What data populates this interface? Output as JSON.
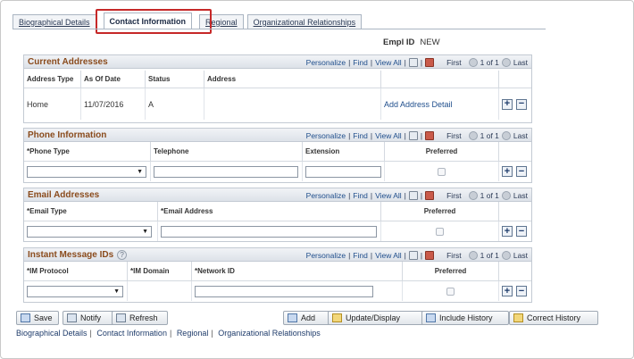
{
  "tabs": [
    {
      "label": "Biographical Details"
    },
    {
      "label": "Contact Information"
    },
    {
      "label": "Regional"
    },
    {
      "label": "Organizational Relationships"
    }
  ],
  "empl": {
    "label": "Empl ID",
    "value": "NEW"
  },
  "nav": {
    "personalize": "Personalize",
    "find": "Find",
    "view_all": "View All",
    "first": "First",
    "range": "1 of 1",
    "last": "Last",
    "sep": "|"
  },
  "addresses": {
    "title": "Current Addresses",
    "columns": [
      "Address Type",
      "As Of Date",
      "Status",
      "Address"
    ],
    "row": {
      "type": "Home",
      "date": "11/07/2016",
      "status": "A",
      "link": "Add Address Detail"
    }
  },
  "phone": {
    "title": "Phone Information",
    "columns": [
      "*Phone Type",
      "Telephone",
      "Extension",
      "Preferred"
    ]
  },
  "email": {
    "title": "Email Addresses",
    "columns": [
      "*Email Type",
      "*Email Address",
      "Preferred"
    ]
  },
  "im": {
    "title": "Instant Message IDs",
    "columns": [
      "*IM Protocol",
      "*IM Domain",
      "*Network ID",
      "Preferred"
    ]
  },
  "buttons": {
    "save": "Save",
    "notify": "Notify",
    "refresh": "Refresh",
    "add": "Add",
    "update": "Update/Display",
    "history": "Include History",
    "correct": "Correct History"
  },
  "footer_links": [
    "Biographical Details",
    "Contact Information",
    "Regional",
    "Organizational Relationships"
  ],
  "symbols": {
    "plus": "+",
    "minus": "−",
    "arrow": "▼",
    "question": "?"
  }
}
